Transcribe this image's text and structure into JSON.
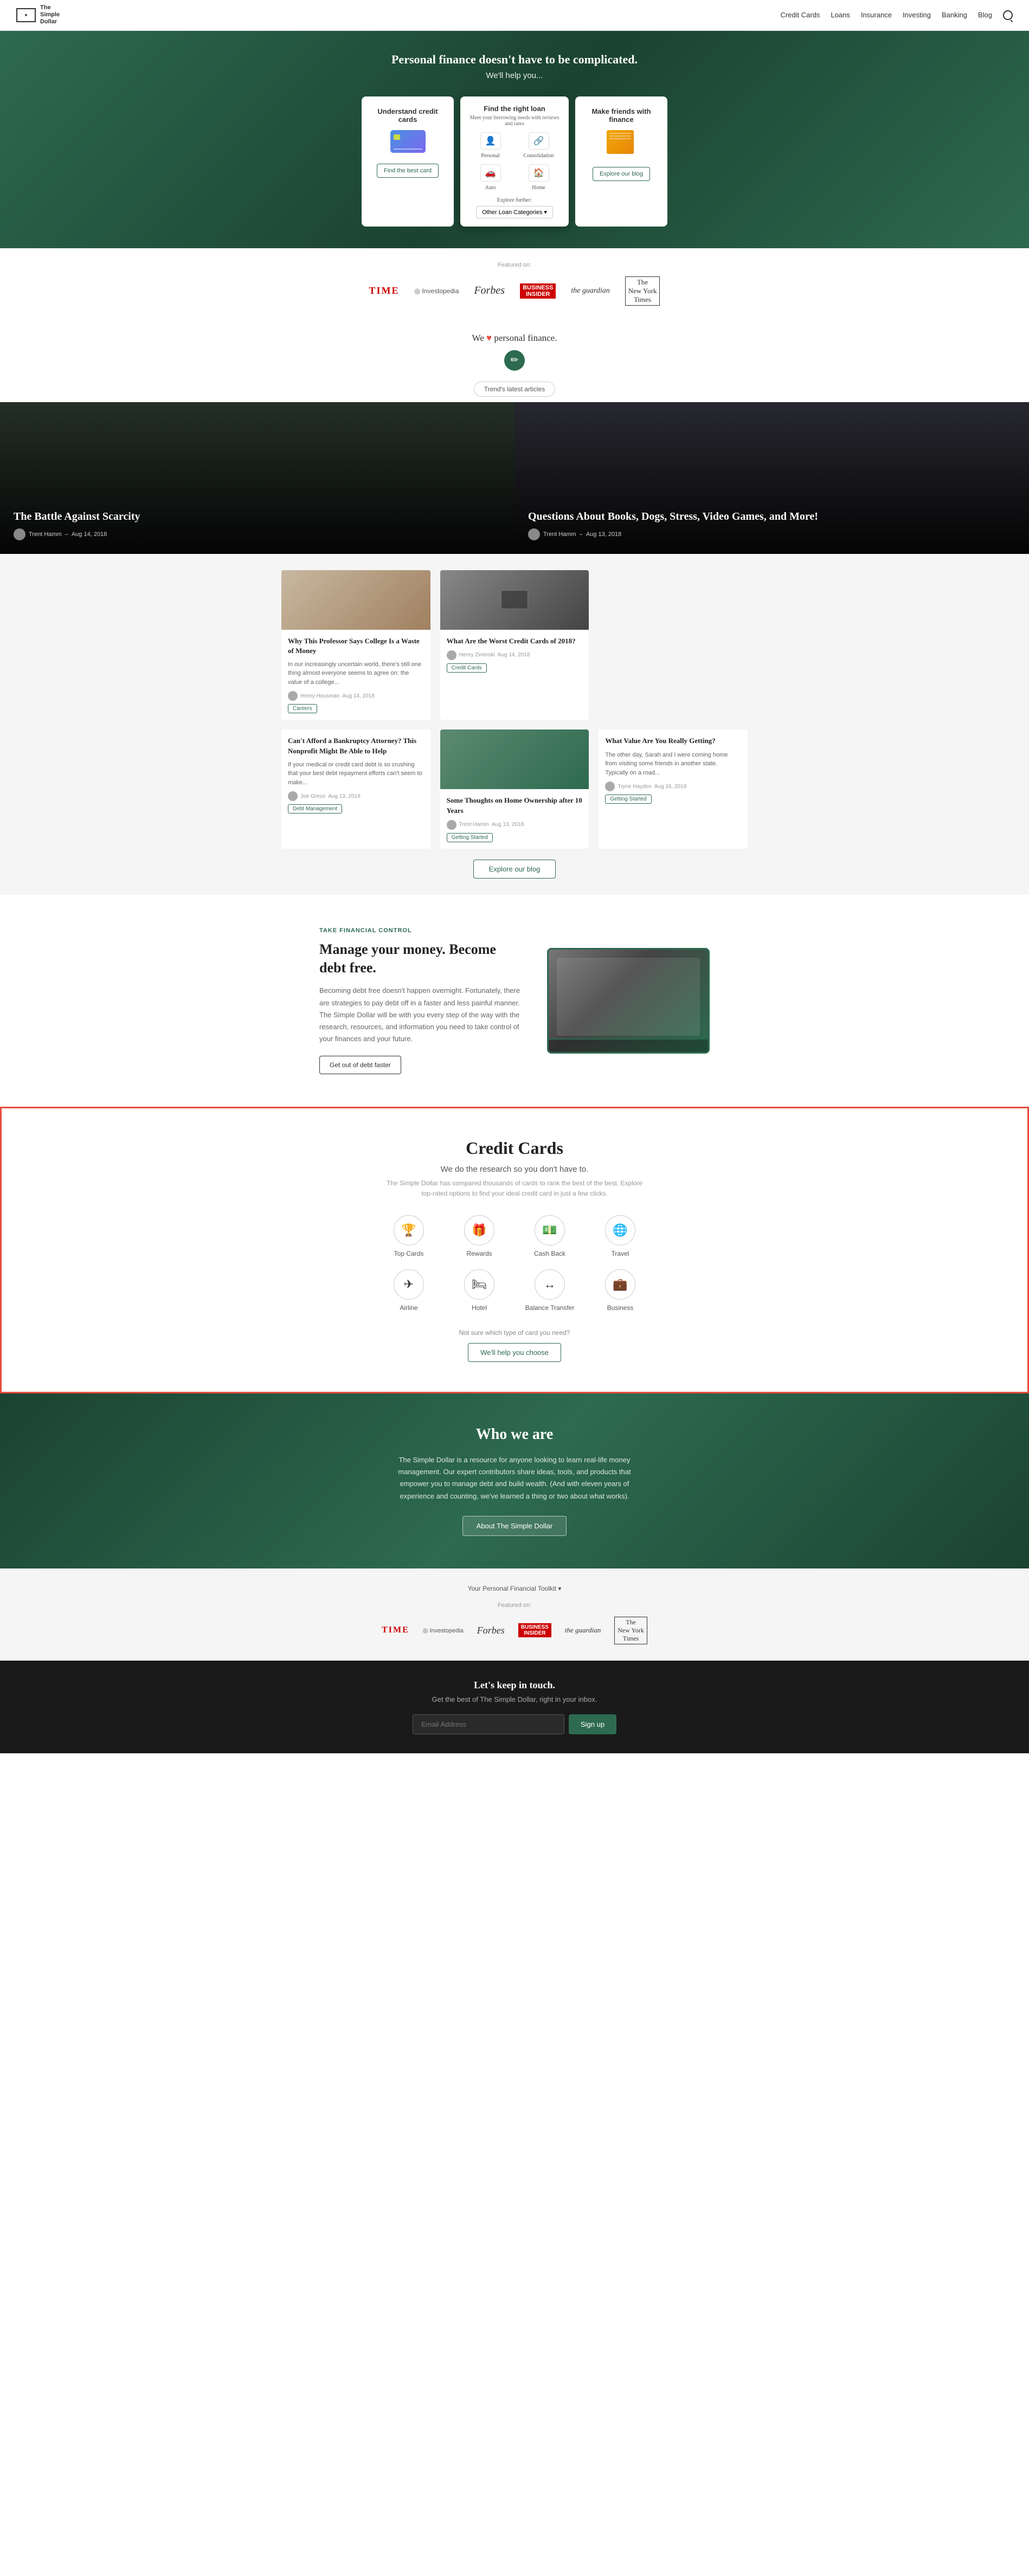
{
  "nav": {
    "logo_text": "The Simple Dollar",
    "links": [
      "Credit Cards",
      "Loans",
      "Insurance",
      "Investing",
      "Banking",
      "Blog"
    ],
    "search_label": "search"
  },
  "hero": {
    "headline": "Personal finance doesn't have to be complicated.",
    "subheadline": "We'll help you...",
    "cards": [
      {
        "id": "credit",
        "title": "Understand credit cards",
        "cta": "Find the best card"
      },
      {
        "id": "loans",
        "title": "Find the right loan",
        "subtitle": "Meet your borrowing needs with reviews and rates",
        "loan_types": [
          {
            "label": "Personal",
            "icon": "👤"
          },
          {
            "label": "Consolidation",
            "icon": "🔗"
          },
          {
            "label": "Auto",
            "icon": "🚗"
          },
          {
            "label": "Home",
            "icon": "🏠"
          }
        ],
        "explore_label": "Explore further:",
        "dropdown_label": "Other Loan Categories ▾"
      },
      {
        "id": "invest",
        "title": "Make friends with finance",
        "cta": "Explore our blog"
      }
    ]
  },
  "featured_in": {
    "label": "Featured on:",
    "outlets": [
      "TIME",
      "Investopedia",
      "Forbes",
      "Business Insider",
      "the guardian",
      "The New York Times"
    ]
  },
  "we_love": {
    "text": "We ❤ personal finance.",
    "trending_label": "Trend's latest articles"
  },
  "blog_hero": {
    "articles": [
      {
        "title": "The Battle Against Scarcity",
        "author": "Trent Hamm",
        "date": "Aug 14, 2018"
      },
      {
        "title": "Questions About Books, Dogs, Stress, Video Games, and More!",
        "author": "Trent Hamm",
        "date": "Aug 13, 2018"
      }
    ]
  },
  "articles": {
    "explore_btn": "Explore our blog",
    "items": [
      {
        "title": "Why This Professor Says College Is a Waste of Money",
        "excerpt": "In our increasingly uncertain world, there's still one thing almost everyone seems to agree on: the value of a college...",
        "author": "Henry Housman",
        "date": "Aug 14, 2018",
        "tag": "Careers"
      },
      {
        "title": "What Are the Worst Credit Cards of 2018?",
        "author": "Henry Ziminski",
        "date": "Aug 14, 2018",
        "tag": "Credit Cards",
        "excerpt": ""
      },
      {
        "title": "Can't Afford a Bankruptcy Attorney? This Nonprofit Might Be Able to Help",
        "excerpt": "If your medical or credit card debt is so crushing that your best debt repayment efforts can't seem to make...",
        "author": "Joe Greco",
        "date": "Aug 13, 2018",
        "tag": "Debt Management"
      },
      {
        "title": "Some Thoughts on Home Ownership after 10 Years",
        "excerpt": "",
        "author": "Trent Hamm",
        "date": "Aug 13, 2018",
        "tag": "Getting Started"
      },
      {
        "title": "What Value Are You Really Getting?",
        "excerpt": "The other day, Sarah and I were coming home from visiting some friends in another state. Typically on a road...",
        "author": "Tryne Hayden",
        "date": "Aug 16, 2018",
        "tag": "Getting Started"
      }
    ]
  },
  "debt_free": {
    "label": "TAKE FINANCIAL CONTROL",
    "headline": "Manage your money. Become debt free.",
    "body": "Becoming debt free doesn't happen overnight. Fortunately, there are strategies to pay debt off in a faster and less painful manner. The Simple Dollar will be with you every step of the way with the research, resources, and information you need to take control of your finances and your future.",
    "cta": "Get out of debt faster"
  },
  "credit_cards": {
    "headline": "Credit Cards",
    "subtitle": "We do the research so you don't have to.",
    "description": "The Simple Dollar has compared thousands of cards to rank the best of the best. Explore top-rated options to find your ideal credit card in just a few clicks.",
    "categories": [
      {
        "label": "Top Cards",
        "icon": "🏆"
      },
      {
        "label": "Rewards",
        "icon": "🎁"
      },
      {
        "label": "Cash Back",
        "icon": "💵"
      },
      {
        "label": "Travel",
        "icon": "🌐"
      },
      {
        "label": "Airline",
        "icon": "✈"
      },
      {
        "label": "Hotel",
        "icon": "🛏"
      },
      {
        "label": "Balance Transfer",
        "icon": "↔"
      },
      {
        "label": "Business",
        "icon": "💼"
      }
    ],
    "help_text": "Not sure which type of card you need?",
    "help_btn": "We'll help you choose"
  },
  "who_we_are": {
    "headline": "Who we are",
    "body": "The Simple Dollar is a resource for anyone looking to learn real-life money management. Our expert contributors share ideas, tools, and products that empower you to manage debt and build wealth. (And with eleven years of experience and counting, we've learned a thing or two about what works).",
    "cta": "About The Simple Dollar"
  },
  "footer_toolkit": {
    "label": "Your Personal Financial Toolkit ▾"
  },
  "footer_featured": {
    "label": "Featured on:",
    "outlets": [
      "TIME",
      "Investopedia",
      "Forbes",
      "Business Insider",
      "the guardian",
      "The New York Times"
    ]
  },
  "newsletter": {
    "headline": "Let's keep in touch.",
    "body": "Get the best of The Simple Dollar, right in your inbox.",
    "input_placeholder": "Email Address",
    "btn_label": "Sign up"
  }
}
